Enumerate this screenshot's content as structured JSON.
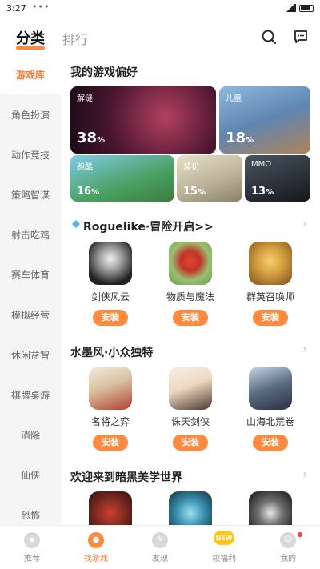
{
  "status": {
    "time": "3:27",
    "dots": "•••"
  },
  "header": {
    "active_tab": "分类",
    "other_tab": "排行"
  },
  "sidebar": {
    "items": [
      {
        "label": "游戏库",
        "active": true
      },
      {
        "label": "角色扮演"
      },
      {
        "label": "动作竞技"
      },
      {
        "label": "策略智谋"
      },
      {
        "label": "射击吃鸡"
      },
      {
        "label": "赛车体育"
      },
      {
        "label": "模拟经营"
      },
      {
        "label": "休闲益智"
      },
      {
        "label": "棋牌桌游"
      },
      {
        "label": "消除"
      },
      {
        "label": "仙侠"
      },
      {
        "label": "恐怖"
      }
    ]
  },
  "prefs": {
    "title": "我的游戏偏好",
    "cards": [
      {
        "tag": "解谜",
        "pct": "38",
        "unit": "%"
      },
      {
        "tag": "儿童",
        "pct": "18",
        "unit": "%"
      },
      {
        "tag": "跑酷",
        "pct": "16",
        "unit": "%"
      },
      {
        "tag": "装扮",
        "pct": "15",
        "unit": "%"
      },
      {
        "tag": "MMO",
        "pct": "13",
        "unit": "%"
      }
    ]
  },
  "sections": [
    {
      "title": "Roguelike·冒险开启>>",
      "games": [
        {
          "name": "剑侠风云",
          "install": "安装"
        },
        {
          "name": "物质与魔法",
          "install": "安装"
        },
        {
          "name": "群英召唤师",
          "install": "安装"
        }
      ]
    },
    {
      "title": "水墨风·小众独特",
      "games": [
        {
          "name": "名将之弈",
          "install": "安装"
        },
        {
          "name": "诛天剑侠",
          "install": "安装"
        },
        {
          "name": "山海北荒卷",
          "install": "安装"
        }
      ]
    },
    {
      "title": "欢迎来到暗黑美学世界",
      "games": [
        {},
        {},
        {}
      ]
    }
  ],
  "bottom_nav": {
    "items": [
      {
        "label": "推荐"
      },
      {
        "label": "找游戏",
        "active": true
      },
      {
        "label": "发现"
      },
      {
        "label": "领福利",
        "badge": "NEW"
      },
      {
        "label": "我的"
      }
    ]
  },
  "colors": {
    "accent": "#ff8a3d",
    "active_text": "#ff7a2e"
  }
}
